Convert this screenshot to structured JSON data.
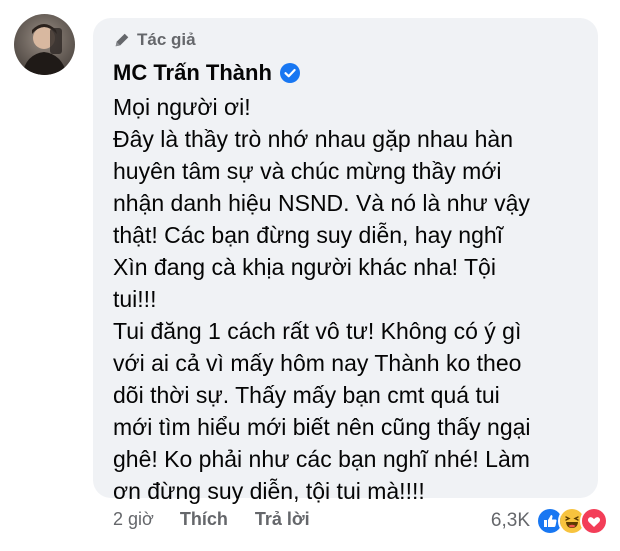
{
  "comment": {
    "author_badge": "Tác giả",
    "author_name": "MC Trấn Thành",
    "lines": [
      "Mọi người ơi!",
      "Đây là thầy trò nhớ nhau gặp nhau hàn",
      "huyên tâm sự và chúc mừng thầy mới",
      "nhận danh hiệu NSND. Và nó là như vậy",
      "thật! Các bạn đừng suy diễn, hay nghĩ",
      "Xìn đang cà khịa người khác nha! Tội",
      "tui!!!",
      "Tui đăng 1 cách rất vô tư! Không có ý gì",
      "với ai cả vì mấy hôm nay Thành ko theo",
      "dõi thời sự. Thấy mấy bạn cmt quá tui",
      "mới tìm hiểu mới biết nên cũng thấy ngại",
      "ghê! Ko phải như các bạn nghĩ nhé! Làm",
      "ơn đừng suy diễn, tội tui mà!!!!"
    ]
  },
  "footer": {
    "time": "2 giờ",
    "like_label": "Thích",
    "reply_label": "Trả lời",
    "reaction_count": "6,3K"
  },
  "colors": {
    "bubble_bg": "#f0f2f5",
    "secondary_text": "#65676b",
    "verified_blue": "#1877f2"
  }
}
